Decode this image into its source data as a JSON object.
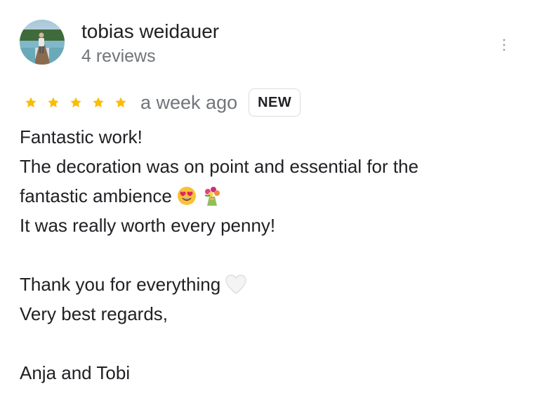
{
  "reviewer": {
    "name": "tobias weidauer",
    "review_count": "4 reviews"
  },
  "rating": {
    "stars": 5,
    "max_stars": 5,
    "star_color": "#fbbc04"
  },
  "review_date": "a week ago",
  "badge": "NEW",
  "review": {
    "line1": "Fantastic work!",
    "line2": "The decoration was on point and essential for the",
    "line3": "fantastic ambience",
    "line4": "It was really worth every penny!",
    "line5": "Thank you for everything",
    "line6": "Very best regards,",
    "line7": "Anja and Tobi"
  },
  "icons": {
    "line3_emojis": [
      "heart-eyes-emoji",
      "bouquet-emoji"
    ],
    "line5_emoji": "white-heart-emoji",
    "menu": "more-vert-icon"
  },
  "colors": {
    "text_primary": "#202124",
    "text_secondary": "#70757a",
    "star": "#fbbc04",
    "badge_border": "#dadce0"
  }
}
